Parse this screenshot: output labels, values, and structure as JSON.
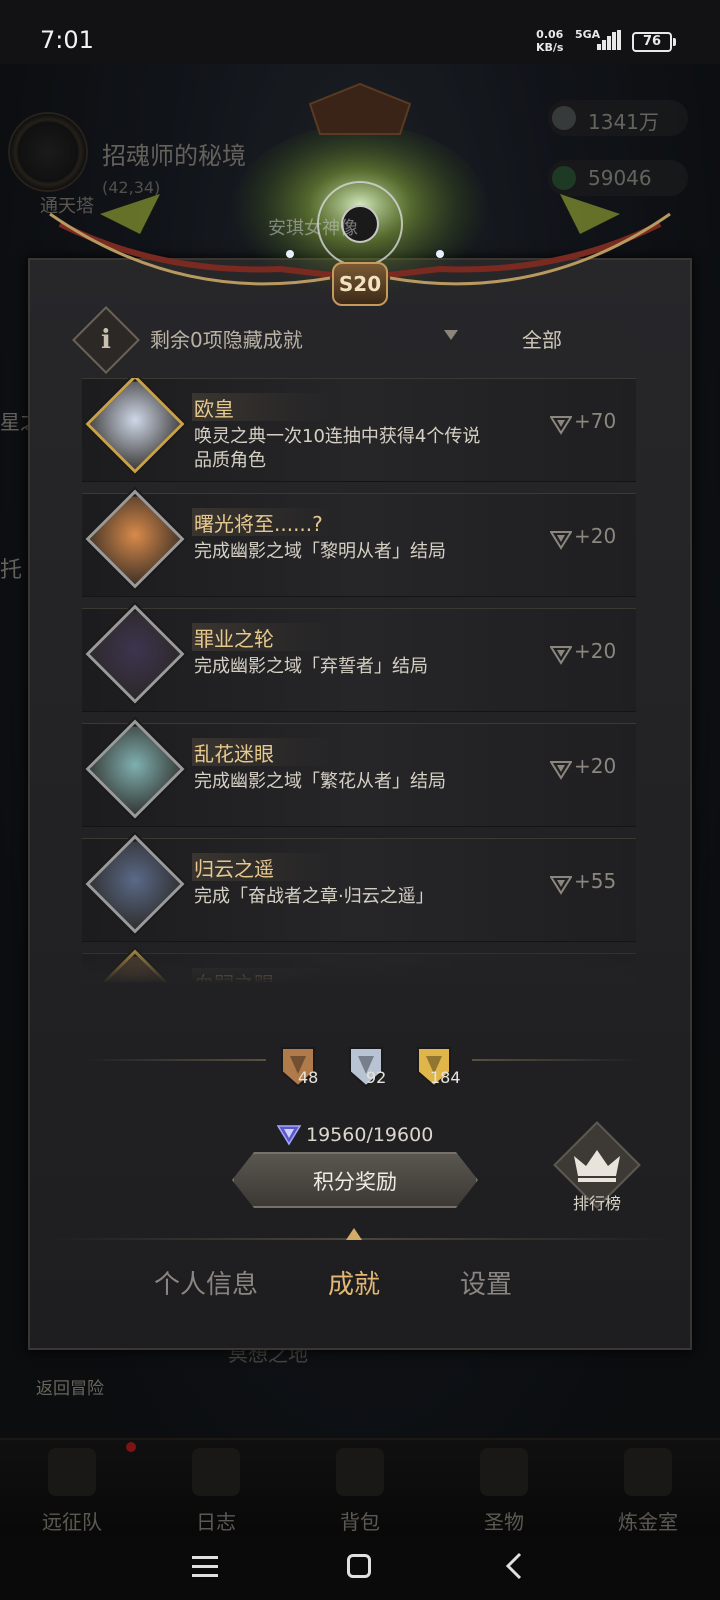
{
  "status_bar": {
    "time": "7:01",
    "net_speed_value": "0.06",
    "net_speed_unit": "KB/s",
    "network": "5GA",
    "battery": "76"
  },
  "background": {
    "realm_title": "招魂师的秘境",
    "realm_coords": "(42,34)",
    "tower_label": "通天塔",
    "resource_1": "1341万",
    "resource_2": "59046",
    "crest_ghost_text": "安琪女神像",
    "left_edge_text_1": "星之",
    "left_edge_text_2": "托",
    "return_label": "返回冒险",
    "chip_label": "冥想之地",
    "bottom_tabs": [
      "远征队",
      "日志",
      "背包",
      "圣物",
      "炼金室"
    ]
  },
  "panel": {
    "season_badge": "S20",
    "hidden_achievements": "剩余0项隐藏成就",
    "filter_value": "全部",
    "achievements": [
      {
        "name": "欧皇",
        "description": "唤灵之典一次10连抽中获得4个传说品质角色",
        "points": "+70",
        "tier": "gold",
        "art_color": "#cfd8e8"
      },
      {
        "name": "曙光将至......?",
        "description": "完成幽影之域「黎明从者」结局",
        "points": "+20",
        "tier": "silver",
        "art_color": "#d98a4a"
      },
      {
        "name": "罪业之轮",
        "description": "完成幽影之域「弃誓者」结局",
        "points": "+20",
        "tier": "silver",
        "art_color": "#3c3550"
      },
      {
        "name": "乱花迷眼",
        "description": "完成幽影之域「繁花从者」结局",
        "points": "+20",
        "tier": "silver",
        "art_color": "#7fb0b0"
      },
      {
        "name": "归云之遥",
        "description": "完成「奋战者之章·归云之遥」",
        "points": "+55",
        "tier": "silver",
        "art_color": "#5a6a88"
      },
      {
        "name": "血嗣之赐",
        "description": "",
        "points": "",
        "tier": "gold",
        "art_color": "#b08050"
      }
    ],
    "medals": [
      {
        "tier": "bronze",
        "count": "48",
        "color": "#b07a4a"
      },
      {
        "tier": "silver",
        "count": "92",
        "color": "#b8c4d4"
      },
      {
        "tier": "gold",
        "count": "184",
        "color": "#e0b64a"
      }
    ],
    "score": "19560/19600",
    "reward_button": "积分奖励",
    "leaderboard": "排行榜",
    "tabs": [
      {
        "label": "个人信息",
        "active": false
      },
      {
        "label": "成就",
        "active": true
      },
      {
        "label": "设置",
        "active": false
      }
    ]
  },
  "colors": {
    "accent_gold": "#e0b774",
    "name_gold": "#e7c98e",
    "panel_bg": "#242426"
  }
}
